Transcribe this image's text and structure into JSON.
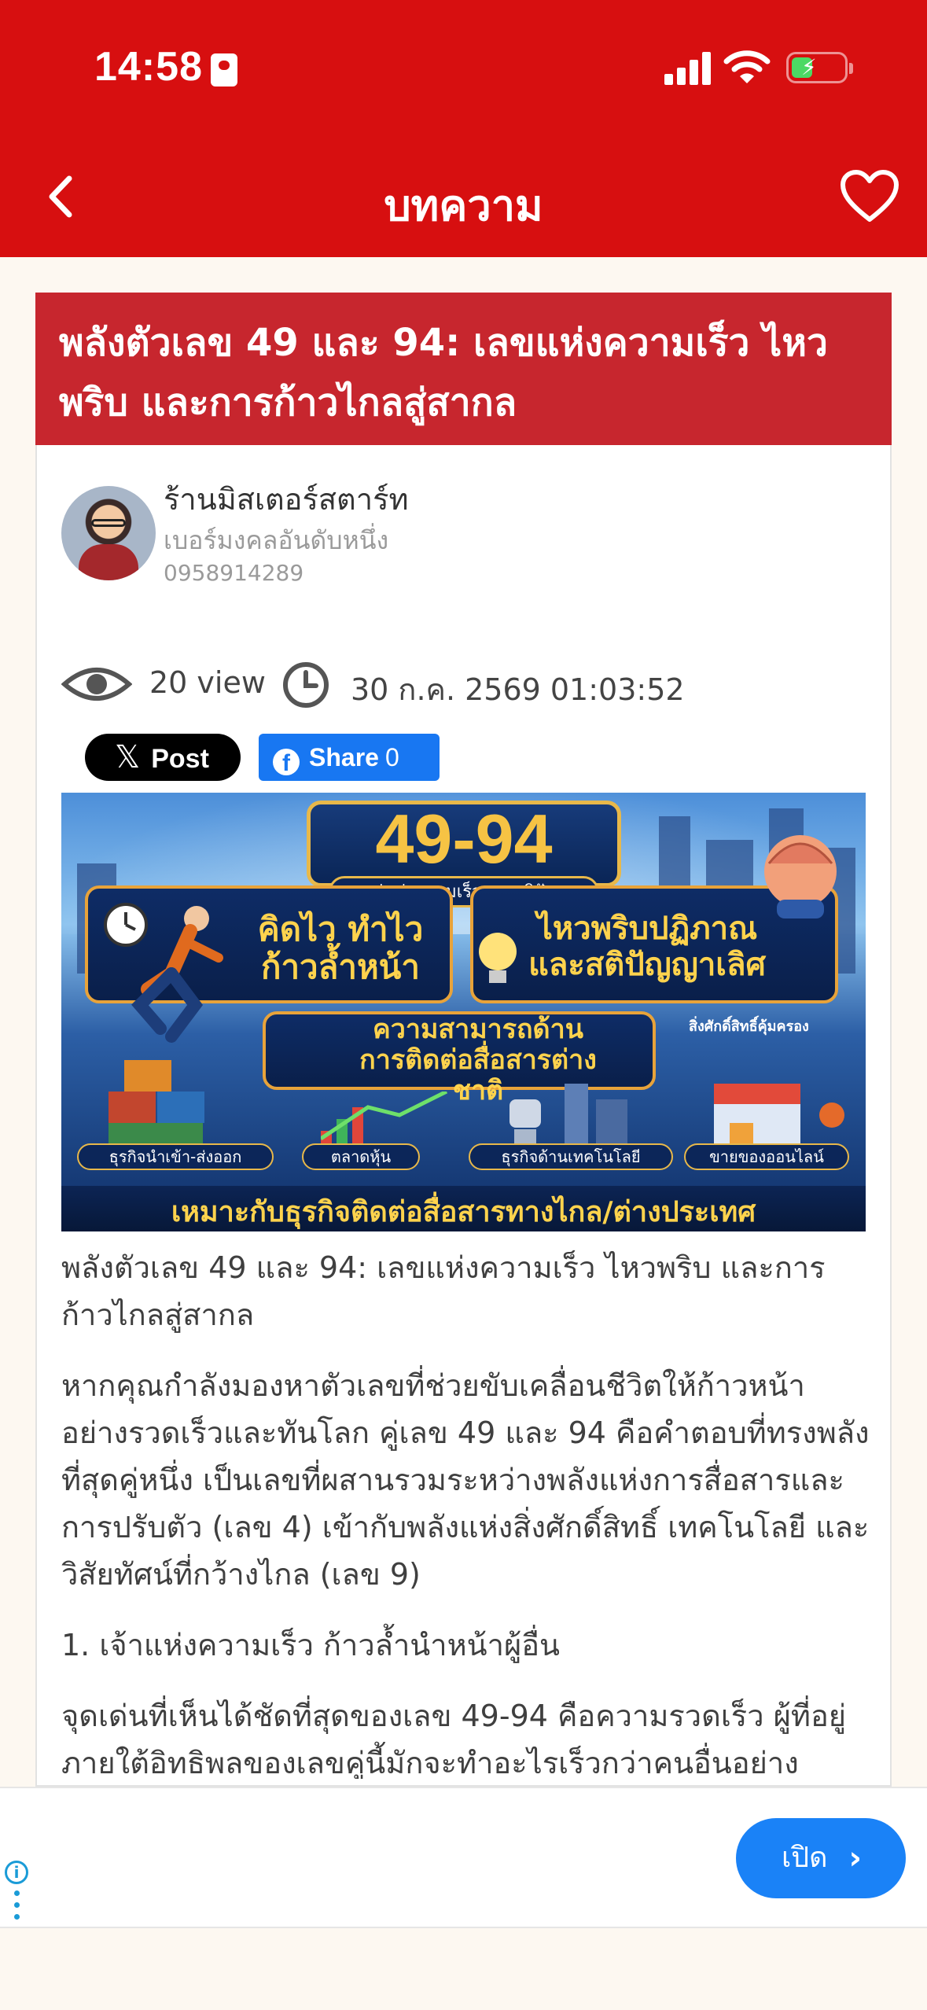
{
  "status_bar": {
    "time": "14:58"
  },
  "header": {
    "title": "บทความ"
  },
  "article": {
    "title": "พลังตัวเลข 49 และ 94: เลขแห่งความเร็ว ไหว\nพริบ และการก้าวไกลสู่สากล",
    "author": {
      "name": "ร้านมิสเตอร์สตาร์ท",
      "tagline": "เบอร์มงคลอันดับหนึ่ง",
      "phone": "0958914289"
    },
    "views": "20 view",
    "date": "30 ก.ค. 2569 01:03:52",
    "share": {
      "x_label": "Post",
      "fb_label": "Share",
      "fb_count": "0"
    },
    "banner": {
      "number": "49-94",
      "subtitle": "เลขคู่แห่งความเร็วและสติปัญญา",
      "panel1": "คิดไว ทำไว\nก้าวล้ำหน้า",
      "panel2": "ไหวพริบปฏิภาณ\nและสติปัญญาเลิศ",
      "panel3": "ความสามารถด้าน\nการติดต่อสื่อสารต่างชาติ",
      "corner_note": "สิ่งศักดิ์สิทธิ์คุ้มครอง",
      "tags": [
        "ธุรกิจนำเข้า-ส่งออก",
        "ตลาดหุ้น",
        "ธุรกิจด้านเทคโนโลยี",
        "ขายของออนไลน์"
      ],
      "footer": "เหมาะกับธุรกิจติดต่อสื่อสารทางไกล/ต่างประเทศ"
    },
    "paragraphs": [
      "พลังตัวเลข 49 และ 94: เลขแห่งความเร็ว ไหวพริบ และการก้าวไกลสู่สากล",
      "หากคุณกำลังมองหาตัวเลขที่ช่วยขับเคลื่อนชีวิตให้ก้าวหน้าอย่างรวดเร็วและทันโลก คู่เลข 49 และ 94 คือคำตอบที่ทรงพลังที่สุดคู่หนึ่ง เป็นเลขที่ผสานรวมระหว่างพลังแห่งการสื่อสารและการปรับตัว (เลข 4) เข้ากับพลังแห่งสิ่งศักดิ์สิทธิ์ เทคโนโลยี และวิสัยทัศน์ที่กว้างไกล (เลข 9)",
      "1. เจ้าแห่งความเร็ว ก้าวล้ำนำหน้าผู้อื่น",
      "จุดเด่นที่เห็นได้ชัดที่สุดของเลข 49-94 คือความรวดเร็ว ผู้ที่อยู่ภายใต้อิทธิพลของเลขคู่นี้มักจะทำอะไรเร็วกว่าคนอื่นอย่าง"
    ]
  },
  "ad": {
    "open_label": "เปิด"
  }
}
